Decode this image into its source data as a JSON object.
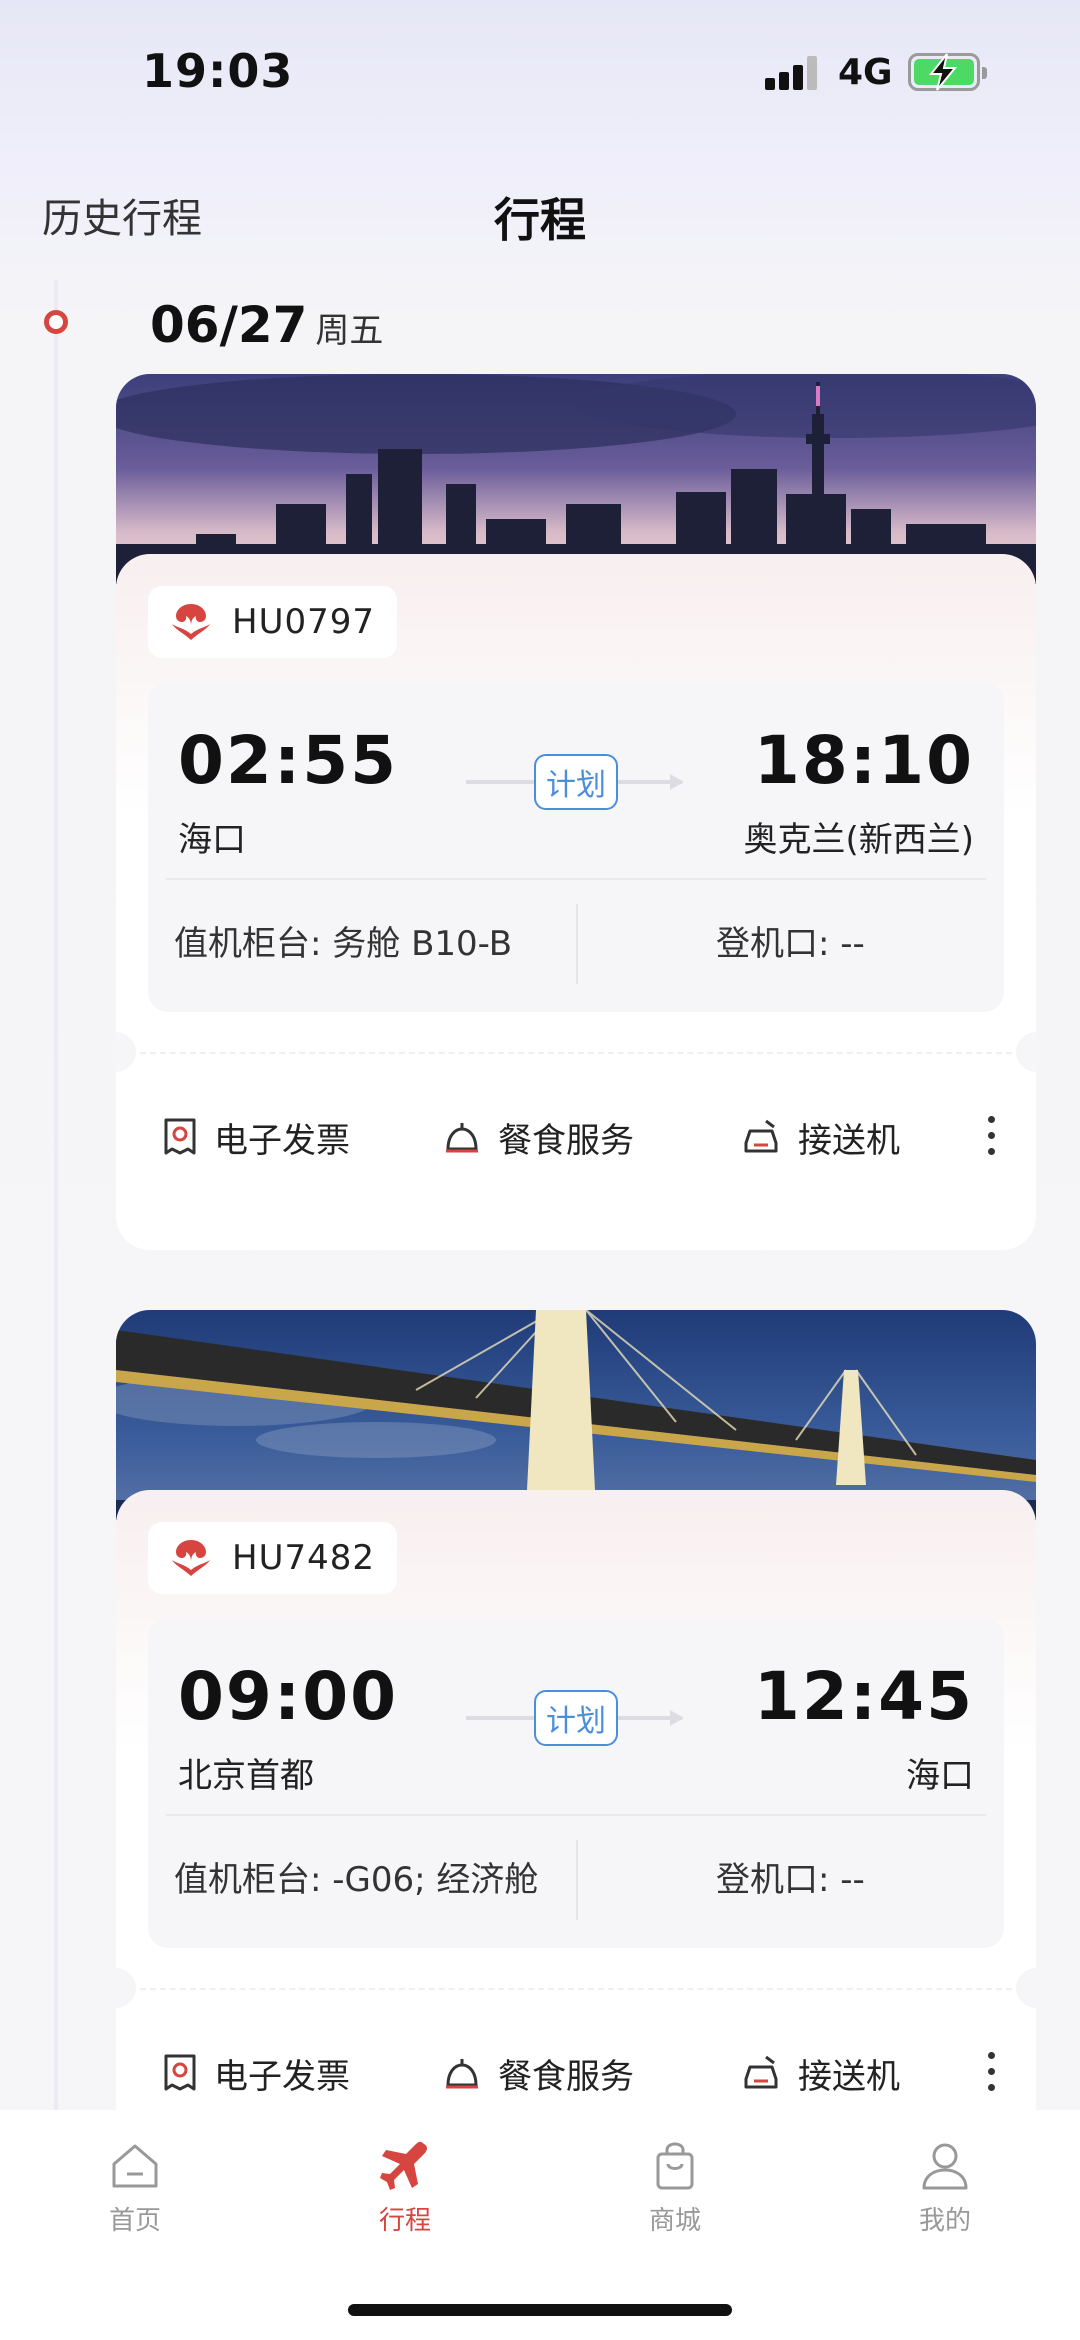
{
  "status_bar": {
    "time": "19:03",
    "network": "4G",
    "battery_color": "#4cd964"
  },
  "header": {
    "history_label": "历史行程",
    "title": "行程"
  },
  "date_group": {
    "date": "06/27",
    "weekday": "周五"
  },
  "flights": [
    {
      "flight_no": "HU0797",
      "dep_time": "02:55",
      "dep_city": "海口",
      "arr_time": "18:10",
      "arr_city": "奥克兰(新西兰)",
      "status": "计划",
      "counter": "值机柜台: 务舱 B10-B",
      "gate": "登机口: --",
      "image": "city-skyline-image"
    },
    {
      "flight_no": "HU7482",
      "dep_time": "09:00",
      "dep_city": "北京首都",
      "arr_time": "12:45",
      "arr_city": "海口",
      "status": "计划",
      "counter": "值机柜台: -G06; 经济舱",
      "gate": "登机口: --",
      "image": "bridge-night-image"
    }
  ],
  "actions": {
    "e_ticket": "电子发票",
    "meal": "餐食服务",
    "transfer": "接送机"
  },
  "tabs": [
    {
      "label": "首页",
      "icon": "home-icon"
    },
    {
      "label": "行程",
      "icon": "plane-icon"
    },
    {
      "label": "商城",
      "icon": "shopping-bag-icon"
    },
    {
      "label": "我的",
      "icon": "user-icon"
    }
  ],
  "colors": {
    "accent": "#d6453f",
    "status_blue": "#4a90d9"
  }
}
